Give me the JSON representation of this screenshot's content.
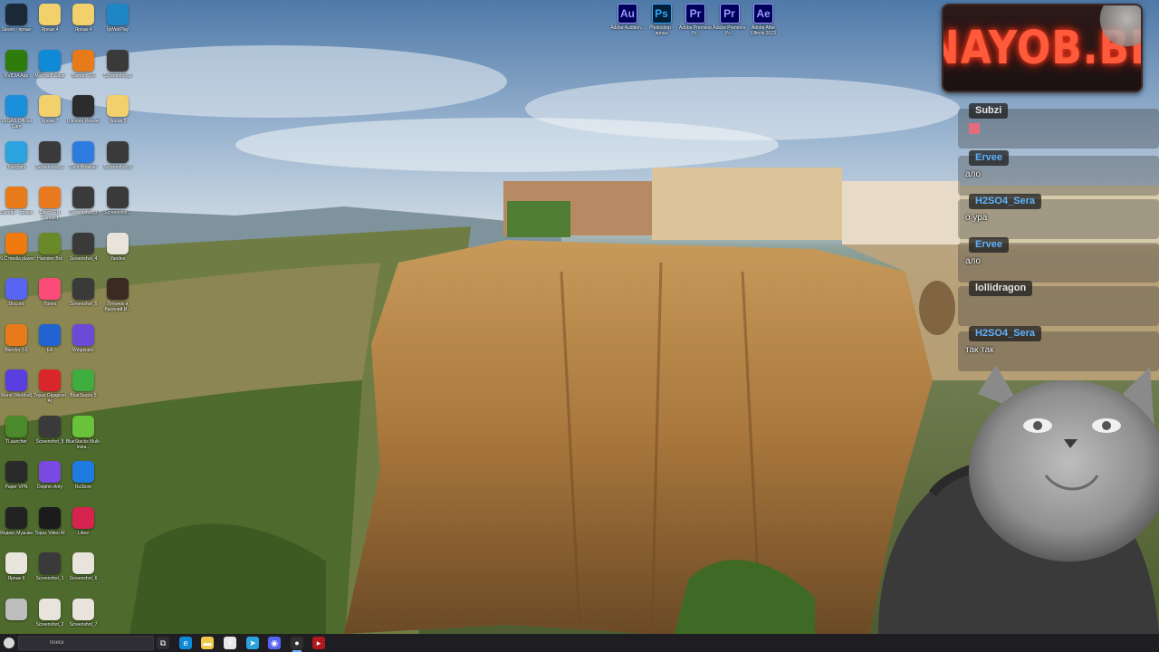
{
  "desktop": {
    "column1": [
      {
        "label": "Steam - ярлык",
        "icon": "steam-icon",
        "color": "#1b2838"
      },
      {
        "label": "NVIDIA App",
        "icon": "nvidia-icon",
        "color": "#2e7d0a"
      },
      {
        "label": "VEGAS Official Cam",
        "icon": "camera-app-icon",
        "color": "#1a8fdc"
      },
      {
        "label": "Telegram",
        "icon": "telegram-icon",
        "color": "#2aa3df"
      },
      {
        "label": "Blender - ярлык",
        "icon": "blender-icon",
        "color": "#e77b19"
      },
      {
        "label": "VLC media player",
        "icon": "vlc-icon",
        "color": "#f17a0e"
      },
      {
        "label": "Discord",
        "icon": "discord-icon",
        "color": "#5865f2"
      },
      {
        "label": "Blender 3.6",
        "icon": "blender-icon",
        "color": "#e77b19"
      },
      {
        "label": "Wand (WeMod)",
        "icon": "wand-icon",
        "color": "#5a3fe0"
      },
      {
        "label": "TLauncher",
        "icon": "minecraft-icon",
        "color": "#4a8a2a"
      },
      {
        "label": "Paper VPN",
        "icon": "vpn-icon",
        "color": "#2a2a2a"
      },
      {
        "label": "Яндекс Музыка",
        "icon": "yandex-music-icon",
        "color": "#222222"
      },
      {
        "label": "Ярлык 6",
        "icon": "file-icon",
        "color": "#e8e4dc"
      },
      {
        "label": "",
        "icon": "cat-paw-icon",
        "color": "#bdbdbd"
      }
    ],
    "column2": [
      {
        "label": "Ярлык 4",
        "icon": "folder-icon",
        "color": "#f2d06b"
      },
      {
        "label": "Microsoft Edge",
        "icon": "edge-icon",
        "color": "#0e8ad6"
      },
      {
        "label": "Ярлык 7",
        "icon": "folder-icon",
        "color": "#f2d06b"
      },
      {
        "label": "Screenshot_1",
        "icon": "screenshot-icon",
        "color": "#3a3a3a"
      },
      {
        "label": "OpenVPN Connect",
        "icon": "openvpn-icon",
        "color": "#ea7a20"
      },
      {
        "label": "Hamster Bot",
        "icon": "hamster-icon",
        "color": "#6a8a2a"
      },
      {
        "label": "iTunes",
        "icon": "itunes-icon",
        "color": "#fb4b78"
      },
      {
        "label": "EA",
        "icon": "ea-icon",
        "color": "#2164d1"
      },
      {
        "label": "Topaz Gigapixel AI",
        "icon": "topaz-icon",
        "color": "#d8262b"
      },
      {
        "label": "Screenshot_8",
        "icon": "screenshot-icon",
        "color": "#3a3a3a"
      },
      {
        "label": "Dolphin Anty",
        "icon": "dolphin-icon",
        "color": "#7b4ae2"
      },
      {
        "label": "Topaz Video AI",
        "icon": "topaz-video-icon",
        "color": "#1b1b1b"
      },
      {
        "label": "Screenshot_1",
        "icon": "screenshot-icon",
        "color": "#3a3a3a"
      },
      {
        "label": "Screenshot_2",
        "icon": "screenshot-icon",
        "color": "#e8e4dc"
      }
    ],
    "column3": [
      {
        "label": "Ярлык 4",
        "icon": "folder-icon",
        "color": "#f2d06b"
      },
      {
        "label": "Blender 3.6",
        "icon": "blender-icon",
        "color": "#e77b19"
      },
      {
        "label": "Ultimate Reader",
        "icon": "reader-icon",
        "color": "#2c2c2c"
      },
      {
        "label": "Cent Browser",
        "icon": "cent-browser-icon",
        "color": "#2e7be0"
      },
      {
        "label": "Screenshot_3",
        "icon": "screenshot-icon",
        "color": "#3a3a3a"
      },
      {
        "label": "Screenshot_4",
        "icon": "screenshot-icon",
        "color": "#3a3a3a"
      },
      {
        "label": "Screenshot_5",
        "icon": "screenshot-icon",
        "color": "#3a3a3a"
      },
      {
        "label": "Winpinator",
        "icon": "winpinator-icon",
        "color": "#6b4ad8"
      },
      {
        "label": "BlueStacks 5",
        "icon": "bluestacks-icon",
        "color": "#3fae3f"
      },
      {
        "label": "BlueStacks Multi-Insta...",
        "icon": "bluestacks-icon",
        "color": "#6ac23a"
      },
      {
        "label": "RuStore",
        "icon": "rustore-icon",
        "color": "#1e7be0"
      },
      {
        "label": "Likee",
        "icon": "likee-icon",
        "color": "#d6234f"
      },
      {
        "label": "Screenshot_6",
        "icon": "screenshot-icon",
        "color": "#e8e4dc"
      },
      {
        "label": "Screenshot_7",
        "icon": "screenshot-icon",
        "color": "#e8e4dc"
      }
    ],
    "column4": [
      {
        "label": "tgWebPlay",
        "icon": "t-icon",
        "color": "#1f86c6"
      },
      {
        "label": "Screenshot_2",
        "icon": "screenshot-icon",
        "color": "#3a3a3a"
      },
      {
        "label": "Ярлык 5",
        "icon": "folder-icon",
        "color": "#f2d06b"
      },
      {
        "label": "Screenshot_9",
        "icon": "screenshot-icon",
        "color": "#3a3a3a"
      },
      {
        "label": "Screenshot...",
        "icon": "screenshot-icon",
        "color": "#3a3a3a"
      },
      {
        "label": "Yandex",
        "icon": "yandex-icon",
        "color": "#e8e4dc"
      },
      {
        "label": "Пятачок и Василий И...",
        "icon": "photo-icon",
        "color": "#3b2a22"
      }
    ],
    "adobe": [
      {
        "abbr": "Au",
        "label": "Adobe Audition...",
        "icon": "audition-icon",
        "color": "#00005b",
        "fg": "#9999ff"
      },
      {
        "abbr": "Ps",
        "label": "Photoshop - ярлык",
        "icon": "photoshop-icon",
        "color": "#001e36",
        "fg": "#31a8ff"
      },
      {
        "abbr": "Pr",
        "label": "Adobe Premiere Pr...",
        "icon": "premiere-icon",
        "color": "#00005b",
        "fg": "#9999ff"
      },
      {
        "abbr": "Pr",
        "label": "Adobe Premiere Pr...",
        "icon": "premiere-icon",
        "color": "#00005b",
        "fg": "#9999ff"
      },
      {
        "abbr": "Ae",
        "label": "Adobe After Effects 2023",
        "icon": "after-effects-icon",
        "color": "#00005b",
        "fg": "#9999ff"
      }
    ]
  },
  "overlay": {
    "logo_text": "NAYOB.BE",
    "chat": [
      {
        "name": "Subzi",
        "text": "",
        "emoji": true,
        "name_color": "white"
      },
      {
        "name": "Ervee",
        "text": "ало",
        "emoji": false,
        "name_color": "blue"
      },
      {
        "name": "H2SO4_Sera",
        "text": "о ура",
        "emoji": false,
        "name_color": "blue"
      },
      {
        "name": "Ervee",
        "text": "ало",
        "emoji": false,
        "name_color": "blue"
      },
      {
        "name": "lollidragon",
        "text": "",
        "emoji": false,
        "name_color": "white"
      },
      {
        "name": "H2SO4_Sera",
        "text": "так так",
        "emoji": false,
        "name_color": "blue"
      }
    ]
  },
  "taskbar": {
    "search_text": "поиск",
    "apps": [
      {
        "icon": "task-view-icon",
        "color": "#2d2d33",
        "glyph": "⧉"
      },
      {
        "icon": "edge-icon",
        "color": "#0e8ad6",
        "glyph": "e"
      },
      {
        "icon": "file-explorer-icon",
        "color": "#f2c94c",
        "glyph": "▬"
      },
      {
        "icon": "yandex-browser-icon",
        "color": "#e8e8e8",
        "glyph": "Y"
      },
      {
        "icon": "telegram-icon",
        "color": "#2aa3df",
        "glyph": "➤"
      },
      {
        "icon": "discord-icon",
        "color": "#5865f2",
        "glyph": "◉"
      },
      {
        "icon": "obs-icon",
        "color": "#303030",
        "glyph": "●"
      },
      {
        "icon": "app-icon",
        "color": "#b0191e",
        "glyph": "▸"
      }
    ]
  }
}
